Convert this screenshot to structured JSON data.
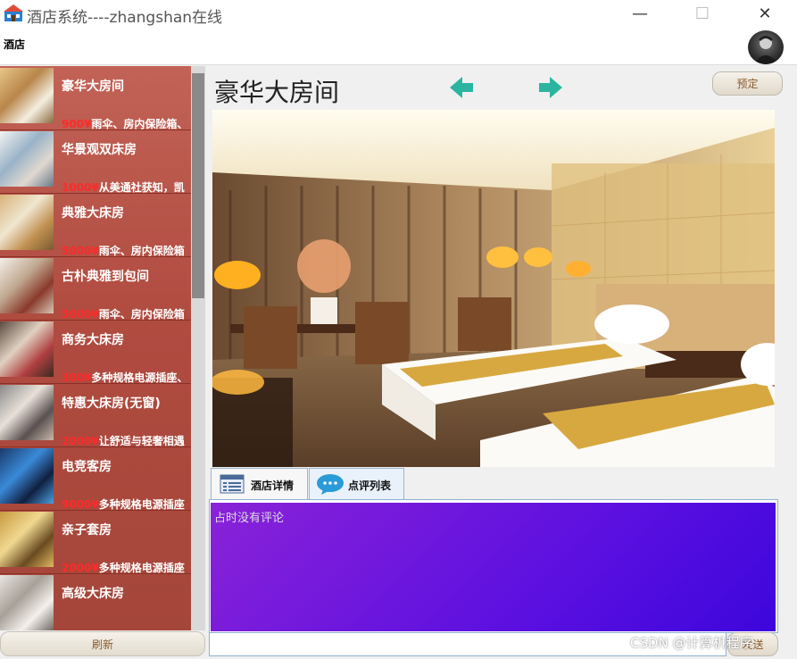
{
  "window": {
    "title": "酒店系统----zhangshan在线",
    "minimize_glyph": "—",
    "maximize_glyph": "☐",
    "close_glyph": "✕",
    "app_icon": "hotel-building-icon"
  },
  "menu": {
    "items": [
      "酒店"
    ]
  },
  "rooms": [
    {
      "name": "豪华大房间",
      "price": "900¥",
      "desc": "雨伞、房内保险箱、"
    },
    {
      "name": "华景观双床房",
      "price": "1000¥",
      "desc": "从美通社获知，凯"
    },
    {
      "name": "典雅大床房",
      "price": "5000¥",
      "desc": "雨伞、房内保险箱"
    },
    {
      "name": "古朴典雅到包间",
      "price": "5000¥",
      "desc": "雨伞、房内保险箱"
    },
    {
      "name": "商务大床房",
      "price": "300¥",
      "desc": "多种规格电源插座、"
    },
    {
      "name": "特惠大床房(无窗)",
      "price": "2000¥",
      "desc": "让舒适与轻奢相遇"
    },
    {
      "name": "电竞客房",
      "price": "9000¥",
      "desc": "多种规格电源插座"
    },
    {
      "name": "亲子套房",
      "price": "2000¥",
      "desc": "多种规格电源插座"
    },
    {
      "name": "高级大床房",
      "price": "",
      "desc": ""
    }
  ],
  "sidebar": {
    "refresh_label": "刷新"
  },
  "detail": {
    "room_title": "豪华大房间",
    "book_label": "预定",
    "prev_icon": "arrow-left-icon",
    "next_icon": "arrow-right-icon"
  },
  "tabs": [
    {
      "label": "酒店详情",
      "icon": "table-list-icon"
    },
    {
      "label": "点评列表",
      "icon": "chat-bubble-icon"
    }
  ],
  "reviews": {
    "empty_text": "占时没有评论",
    "send_label": "发送"
  },
  "watermark": "CSDN @计算机程序",
  "colors": {
    "list_bg": "#b04b40",
    "price": "#ff2a2a",
    "arrow": "#2bb5a0",
    "review_bg": "#5c10e0"
  }
}
